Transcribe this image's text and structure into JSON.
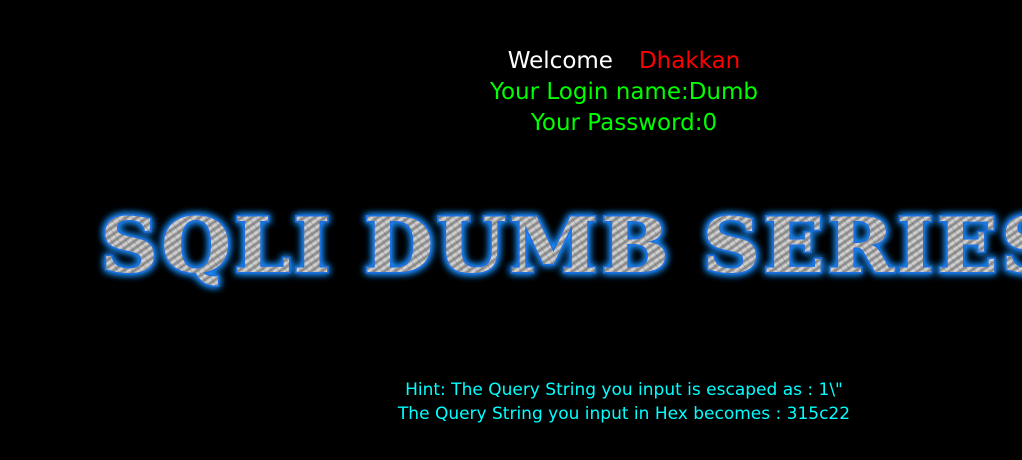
{
  "welcome": {
    "label": "Welcome",
    "user": "Dhakkan"
  },
  "login": {
    "name_line": "Your Login name:Dumb",
    "password_line": "Your Password:0"
  },
  "banner": {
    "text": "SQLI DUMB SERIES-",
    "glow_color": "#1e90ff"
  },
  "hint": {
    "escaped_line": "Hint: The Query String you input is escaped as : 1\\\"",
    "hex_line": "The Query String you input in Hex becomes : 315c22"
  },
  "colors": {
    "background": "#000000",
    "welcome": "#ffffff",
    "user": "#ff0000",
    "login": "#00ff00",
    "hint": "#00ffff"
  }
}
